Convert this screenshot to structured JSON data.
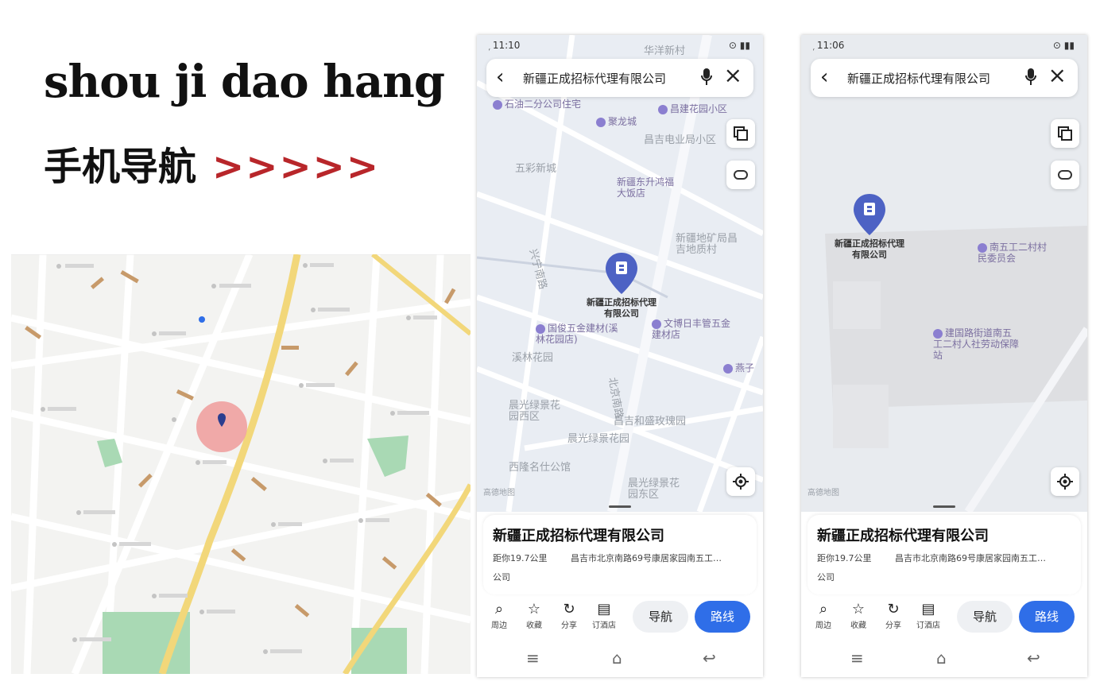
{
  "header": {
    "title_en": "shou ji dao hang",
    "title_cn": "手机导航",
    "arrows": ">>>>>"
  },
  "colors": {
    "accent_red": "#b8262a",
    "route_blue": "#2f6ee8",
    "map_road_yellow": "#f2d77a",
    "park_green": "#a9d9b4",
    "highlight_circle": "#ef9b9b"
  },
  "phone1": {
    "status": {
      "time": "11:10",
      "left": "᷊ 11:10",
      "right": "⊙ ▮▮"
    },
    "search": {
      "query": "新疆正成招标代理有限公司"
    },
    "map_labels": [
      "石油二分公司住宅",
      "聚龙城",
      "昌建花园小区",
      "昌吉电业局小区",
      "五彩新城",
      "新疆东升鸿福大饭店",
      "新疆地矿局昌吉地质村",
      "国俊五金建材(溪林花园店)",
      "文博日丰管五金建材店",
      "溪林花园",
      "晨光绿景花园西区",
      "昌吉和盛玫瑰园",
      "晨光绿景花园",
      "西隆名仕公馆",
      "晨光绿景花园东区",
      "北京南路",
      "兴宁南路",
      "华洋新村",
      "燕子"
    ],
    "pin_label": "新疆正成招标代理有限公司",
    "watermark": "高德地图",
    "card": {
      "name": "新疆正成招标代理有限公司",
      "distance": "距你19.7公里",
      "address": "昌吉市北京南路69号康居家园南五工…",
      "address2": "公司"
    },
    "actions": [
      {
        "icon": "search-icon",
        "label": "周边"
      },
      {
        "icon": "star-icon",
        "label": "收藏"
      },
      {
        "icon": "share-icon",
        "label": "分享"
      },
      {
        "icon": "hotel-icon",
        "label": "订酒店"
      }
    ],
    "nav_label": "导航",
    "route_label": "路线"
  },
  "phone2": {
    "status": {
      "time": "11:06",
      "left": "᷊ 11:06",
      "right": "⊙ ▮▮"
    },
    "search": {
      "query": "新疆正成招标代理有限公司"
    },
    "map_labels": [
      "南五工二村村民委员会",
      "建国路街道南五工二村人社劳动保障站"
    ],
    "pin_label": "新疆正成招标代理有限公司",
    "watermark": "高德地图",
    "card": {
      "name": "新疆正成招标代理有限公司",
      "distance": "距你19.7公里",
      "address": "昌吉市北京南路69号康居家园南五工…",
      "address2": "公司"
    },
    "actions": [
      {
        "icon": "search-icon",
        "label": "周边"
      },
      {
        "icon": "star-icon",
        "label": "收藏"
      },
      {
        "icon": "share-icon",
        "label": "分享"
      },
      {
        "icon": "hotel-icon",
        "label": "订酒店"
      }
    ],
    "nav_label": "导航",
    "route_label": "路线"
  }
}
